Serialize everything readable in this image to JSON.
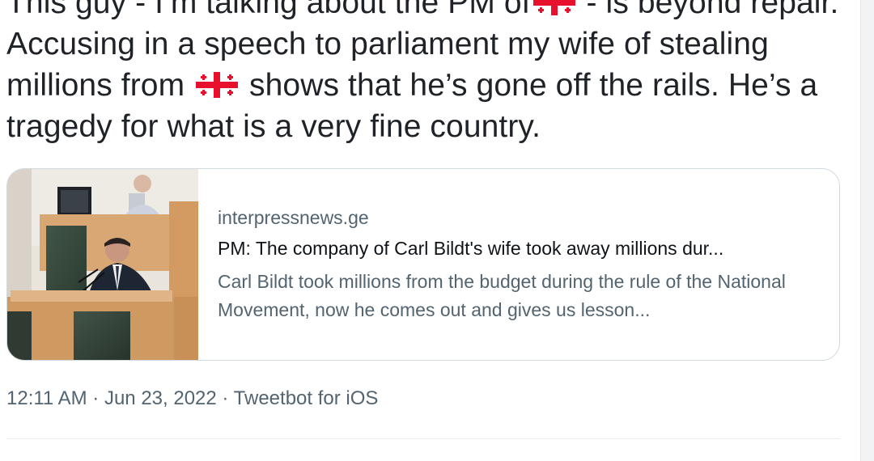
{
  "tweet": {
    "text_part1": "This guy - I’m talking about the PM of",
    "text_part2": " - is beyond repair. Accusing in a speech to parliament my wife of stealing millions from ",
    "text_part3": " shows that he’s gone off the rails. He’s a tragedy for what is a very fine country.",
    "flag_icon": "georgia-flag-icon",
    "flag_colors": {
      "field": "#ffffff",
      "cross": "#e8112d"
    }
  },
  "link_card": {
    "domain": "interpressnews.ge",
    "title": "PM: The company of Carl Bildt's wife took away millions dur...",
    "description": "Carl Bildt took millions from the budget during the rule of the National Movement, now he comes out and gives us lesson..."
  },
  "meta": {
    "time": "12:11 AM",
    "separator": " · ",
    "date": "Jun 23, 2022",
    "source": "Tweetbot for iOS"
  }
}
